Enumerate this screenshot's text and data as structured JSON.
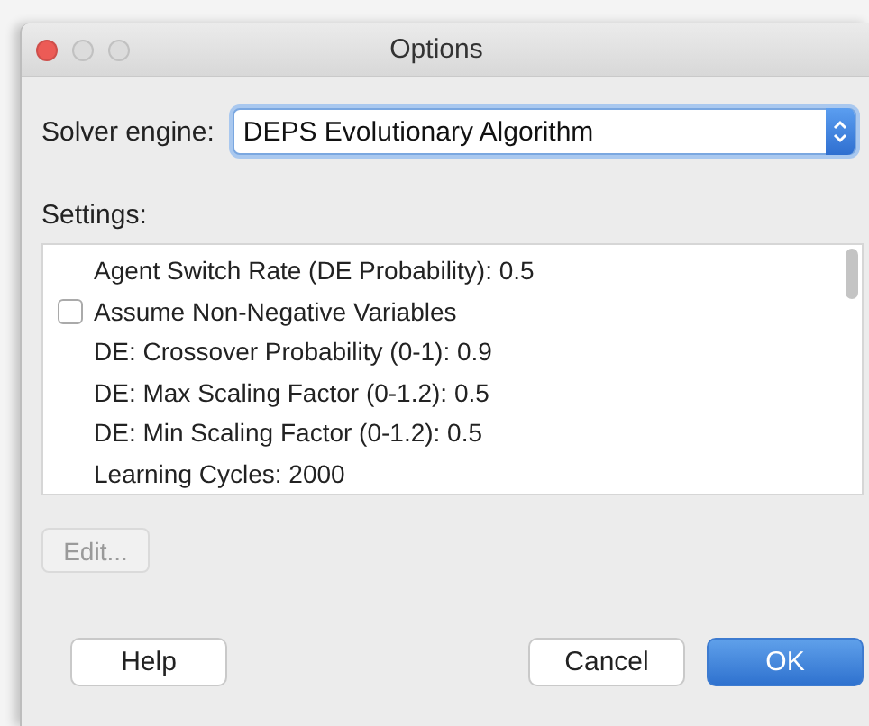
{
  "window": {
    "title": "Options",
    "controls": [
      {
        "color": "#ec5b56"
      },
      {
        "color": "#dcdcdc"
      },
      {
        "color": "#dcdcdc"
      }
    ]
  },
  "solver": {
    "label": "Solver engine:",
    "value": "DEPS Evolutionary Algorithm"
  },
  "settings": {
    "label": "Settings:",
    "items": [
      {
        "kind": "text",
        "label": "Agent Switch Rate (DE Probability): 0.5"
      },
      {
        "kind": "checkbox",
        "label": "Assume Non-Negative Variables",
        "checked": false
      },
      {
        "kind": "text",
        "label": "DE: Crossover Probability (0-1): 0.9"
      },
      {
        "kind": "text",
        "label": "DE: Max Scaling Factor (0-1.2): 0.5"
      },
      {
        "kind": "text",
        "label": "DE: Min Scaling Factor (0-1.2): 0.5"
      },
      {
        "kind": "text",
        "label": "Learning Cycles: 2000"
      }
    ]
  },
  "edit_button": {
    "label": "Edit...",
    "disabled": true
  },
  "buttons": [
    {
      "label": "Help",
      "default": false
    },
    {
      "label": "Cancel",
      "default": false
    },
    {
      "label": "OK",
      "default": true
    }
  ]
}
